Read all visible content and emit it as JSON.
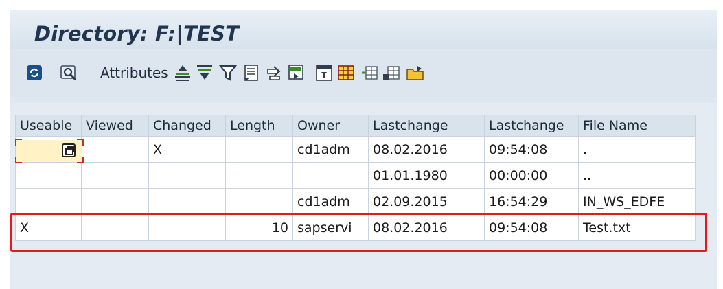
{
  "window": {
    "title": "Directory: F:|TEST"
  },
  "toolbar": {
    "refresh_icon": "refresh-icon",
    "details_icon": "details-icon",
    "attributes_label": "Attributes",
    "icons": [
      "sort-ascending-icon",
      "sort-descending-icon",
      "filter-icon",
      "total-icon",
      "export-icon",
      "print-icon",
      "print-preview-icon",
      "select-layout-icon",
      "change-layout-icon",
      "save-layout-icon",
      "local-file-icon"
    ]
  },
  "table": {
    "columns": [
      "Useable",
      "Viewed",
      "Changed",
      "Length",
      "Owner",
      "Lastchange",
      "Lastchange",
      "File Name"
    ],
    "rows": [
      {
        "useable": "",
        "viewed": "",
        "changed": "X",
        "length": "",
        "owner": "cd1adm",
        "date": "08.02.2016",
        "time": "09:54:08",
        "file": "."
      },
      {
        "useable": "",
        "viewed": "",
        "changed": "",
        "length": "",
        "owner": "",
        "date": "01.01.1980",
        "time": "00:00:00",
        "file": ".."
      },
      {
        "useable": "",
        "viewed": "",
        "changed": "",
        "length": "",
        "owner": "cd1adm",
        "date": "02.09.2015",
        "time": "16:54:29",
        "file": "IN_WS_EDFE"
      },
      {
        "useable": "X",
        "viewed": "",
        "changed": "",
        "length": "10",
        "owner": "sapservi",
        "date": "08.02.2016",
        "time": "09:54:08",
        "file": "Test.txt"
      }
    ]
  },
  "colors": {
    "highlight": "#e41b1b",
    "title_text": "#1f3550",
    "edit_cell": "#fff3c6"
  }
}
